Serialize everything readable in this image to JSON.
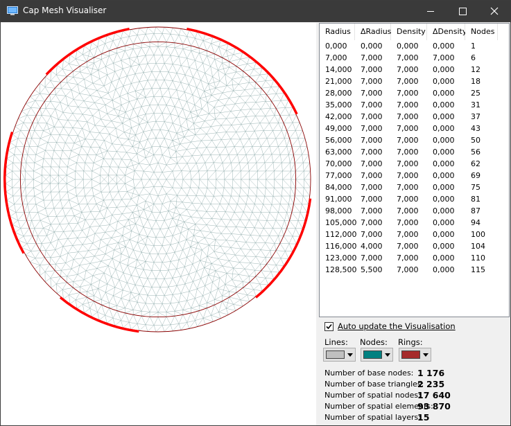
{
  "window": {
    "title": "Cap Mesh Visualiser"
  },
  "table": {
    "columns": [
      "Radius",
      "ΔRadius",
      "Density",
      "ΔDensity",
      "Nodes"
    ],
    "rows": [
      [
        "0,000",
        "0,000",
        "0,000",
        "0,000",
        "1"
      ],
      [
        "7,000",
        "7,000",
        "7,000",
        "7,000",
        "6"
      ],
      [
        "14,000",
        "7,000",
        "7,000",
        "0,000",
        "12"
      ],
      [
        "21,000",
        "7,000",
        "7,000",
        "0,000",
        "18"
      ],
      [
        "28,000",
        "7,000",
        "7,000",
        "0,000",
        "25"
      ],
      [
        "35,000",
        "7,000",
        "7,000",
        "0,000",
        "31"
      ],
      [
        "42,000",
        "7,000",
        "7,000",
        "0,000",
        "37"
      ],
      [
        "49,000",
        "7,000",
        "7,000",
        "0,000",
        "43"
      ],
      [
        "56,000",
        "7,000",
        "7,000",
        "0,000",
        "50"
      ],
      [
        "63,000",
        "7,000",
        "7,000",
        "0,000",
        "56"
      ],
      [
        "70,000",
        "7,000",
        "7,000",
        "0,000",
        "62"
      ],
      [
        "77,000",
        "7,000",
        "7,000",
        "0,000",
        "69"
      ],
      [
        "84,000",
        "7,000",
        "7,000",
        "0,000",
        "75"
      ],
      [
        "91,000",
        "7,000",
        "7,000",
        "0,000",
        "81"
      ],
      [
        "98,000",
        "7,000",
        "7,000",
        "0,000",
        "87"
      ],
      [
        "105,000",
        "7,000",
        "7,000",
        "0,000",
        "94"
      ],
      [
        "112,000",
        "7,000",
        "7,000",
        "0,000",
        "100"
      ],
      [
        "116,000",
        "4,000",
        "7,000",
        "0,000",
        "104"
      ],
      [
        "123,000",
        "7,000",
        "7,000",
        "0,000",
        "110"
      ],
      [
        "128,500",
        "5,500",
        "7,000",
        "0,000",
        "115"
      ]
    ]
  },
  "options": {
    "auto_update_label": "Auto update the Visualisation",
    "auto_update_checked": true,
    "lines_label": "Lines:",
    "nodes_label": "Nodes:",
    "rings_label": "Rings:",
    "colors": {
      "lines": "#c0c0c0",
      "nodes": "#008080",
      "rings": "#a52a2a"
    }
  },
  "stats": [
    {
      "label": "Number of base nodes:",
      "value": "1 176"
    },
    {
      "label": "Number of base triangles:",
      "value": "2 235"
    },
    {
      "label": "Number of spatial nodes:",
      "value": "17 640"
    },
    {
      "label": "Number of spatial elements:",
      "value": "93 870"
    },
    {
      "label": "Number of spatial layers:",
      "value": "15"
    }
  ],
  "mesh": {
    "mesh_line_color": "#7f9f9f",
    "ring_color": "#8b0000",
    "boundary_color": "#ff0000"
  }
}
